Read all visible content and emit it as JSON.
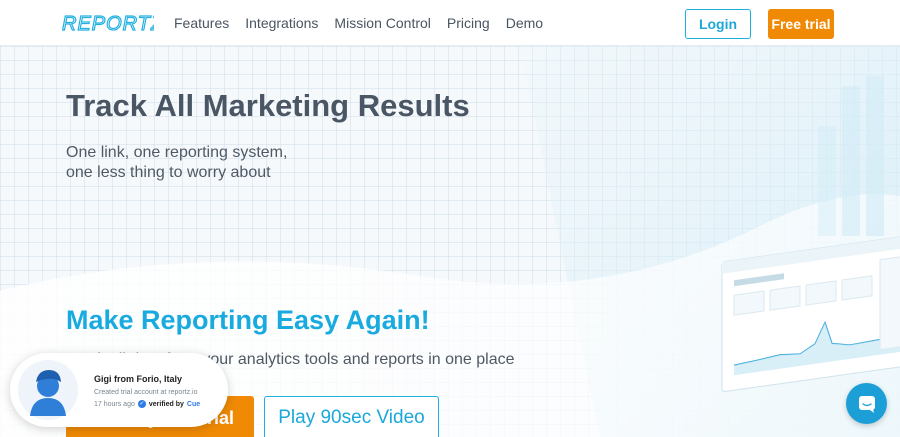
{
  "header": {
    "logo_text": "REPORTZ",
    "nav": [
      "Features",
      "Integrations",
      "Mission Control",
      "Pricing",
      "Demo"
    ],
    "login_label": "Login",
    "free_trial_label": "Free trial"
  },
  "hero": {
    "title": "Track All Marketing Results",
    "subtitle_line1": "One link, one reporting system,",
    "subtitle_line2": "one less thing to worry about"
  },
  "section": {
    "title": "Make Reporting Easy Again!",
    "description": "Track all data from your analytics tools and reports in one place",
    "start_button": "Start my free trial",
    "video_button": "Play 90sec Video"
  },
  "toast": {
    "name": "Gigi from Forio, Italy",
    "action": "Created trial account at reportz.io",
    "time": "17 hours ago",
    "verified": "verified by",
    "verifier": "Cue"
  },
  "colors": {
    "accent_blue": "#19aadf",
    "accent_orange": "#f08a05",
    "heading_gray": "#4a5664"
  },
  "icons": {
    "avatar": "user-avatar-icon",
    "verified": "check-circle-icon",
    "chat": "chat-bubble-icon"
  }
}
